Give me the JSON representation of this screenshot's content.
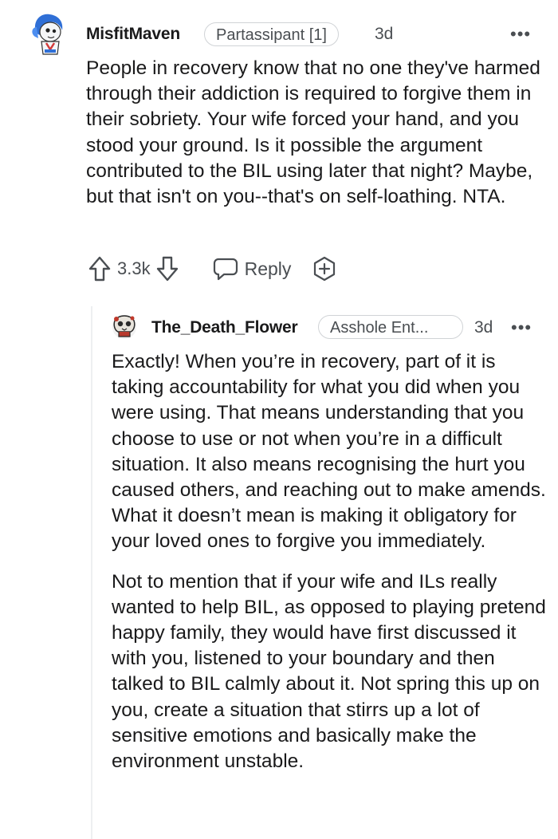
{
  "comment": {
    "username": "MisfitMaven",
    "flair": "Partassipant [1]",
    "time": "3d",
    "more_label": "•••",
    "body": "People in recovery know that no one they've harmed through their addiction is required to forgive them in their sobriety. Your wife forced your hand, and you stood your ground. Is it possible the argument contributed to the BIL using later that night? Maybe, but that isn't on you--that's on self-loathing. NTA.",
    "votes": "3.3k",
    "reply_label": "Reply",
    "icons": [
      "upvote-icon",
      "downvote-icon",
      "reply-icon",
      "award-icon",
      "more-icon"
    ]
  },
  "reply": {
    "username": "The_Death_Flower",
    "flair": "Asshole Ent...",
    "time": "3d",
    "more_label": "•••",
    "paragraphs": [
      "Exactly! When you’re in recovery, part of it is taking accountability for what you did when you were using. That means understanding that you choose to use or not when you’re in a difficult situation. It also means recognising the hurt you caused others, and reaching out to make amends. What it doesn’t mean is making it obligatory for your loved ones to forgive you immediately.",
      "Not to mention that if your wife and ILs really wanted to help BIL, as opposed to playing pretend happy family, they would have first discussed it with you, listened to your boundary and then talked to BIL calmly about it. Not spring this up on you, create a situation that stirrs up a lot of sensitive emotions and basically make the environment unstable."
    ]
  },
  "colors": {
    "text": "#1a1a1b",
    "meta": "#4a4e52",
    "border": "#d0d3d6",
    "thread": "#edeff1"
  }
}
